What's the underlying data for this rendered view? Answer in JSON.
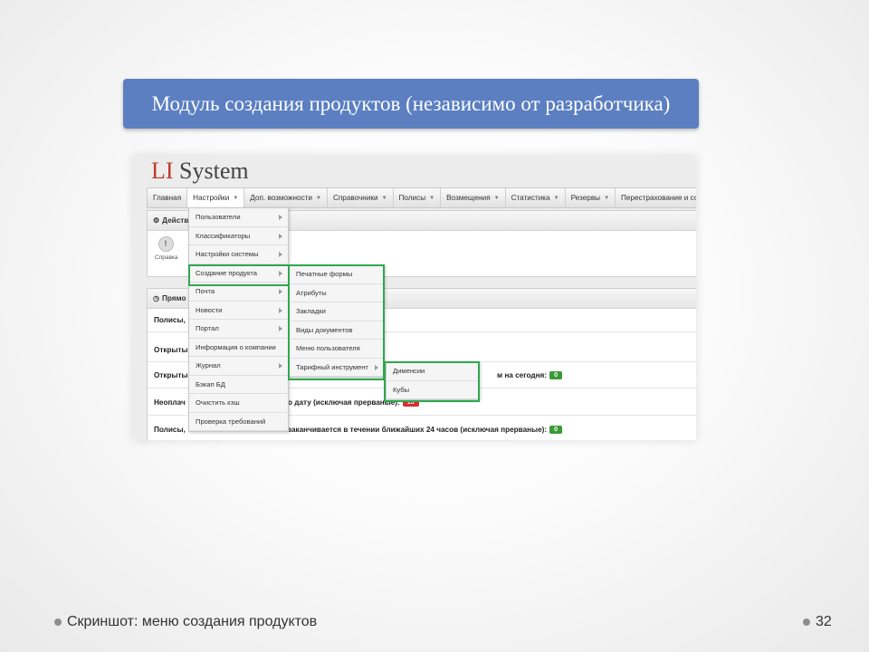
{
  "slide": {
    "title": "Модуль создания продуктов (независимо от разработчика)",
    "caption": "Скриншот: меню создания продуктов",
    "page_number": "32"
  },
  "app": {
    "logo_li": "LI",
    "logo_system": "System",
    "nav": [
      {
        "label": "Главная"
      },
      {
        "label": "Настройки"
      },
      {
        "label": "Доп. возможности"
      },
      {
        "label": "Справочники"
      },
      {
        "label": "Полисы"
      },
      {
        "label": "Возмещения"
      },
      {
        "label": "Статистика"
      },
      {
        "label": "Резервы"
      },
      {
        "label": "Перестрахование и состра"
      }
    ],
    "actions_panel": {
      "title": "Действ",
      "help_label": "Справка"
    },
    "direct_panel": {
      "title": "Прямо",
      "rows": [
        {
          "text": "Полисы,"
        },
        {
          "text": "Открыты"
        },
        {
          "text": "Открыты",
          "suffix": "м на сегодня:",
          "badge": "0"
        },
        {
          "text": "Неоплач",
          "suffix": "о дату (исключая прерваные):",
          "badge": "15"
        },
        {
          "text": "Полисы,",
          "suffix": "заканчивается в течении ближайших 24 часов (исключая прерваные):",
          "badge": "0"
        }
      ]
    },
    "menu_settings": [
      {
        "label": "Пользователи"
      },
      {
        "label": "Классификаторы"
      },
      {
        "label": "Настройки системы"
      },
      {
        "label": "Создание продукта"
      },
      {
        "label": "Почта"
      },
      {
        "label": "Новости"
      },
      {
        "label": "Портал"
      },
      {
        "label": "Информация о компании"
      },
      {
        "label": "Журнал"
      },
      {
        "label": "Бэкап БД"
      },
      {
        "label": "Очистить кэш"
      },
      {
        "label": "Проверка требований"
      }
    ],
    "menu_product": [
      {
        "label": "Печатные формы"
      },
      {
        "label": "Атрибуты"
      },
      {
        "label": "Закладки"
      },
      {
        "label": "Виды документов"
      },
      {
        "label": "Меню пользователя"
      },
      {
        "label": "Тарифный инструмент"
      }
    ],
    "menu_tariff": [
      {
        "label": "Дименсии"
      },
      {
        "label": "Кубы"
      }
    ]
  },
  "colors": {
    "title_bg": "#5b7fc1",
    "highlight": "#2fa84f",
    "badge_green": "#3a9b36",
    "badge_red": "#d53030"
  }
}
